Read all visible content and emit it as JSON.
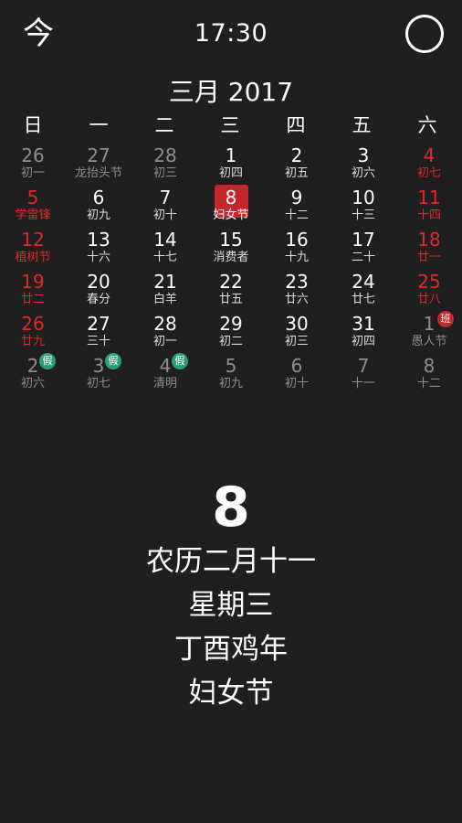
{
  "header": {
    "today_label": "今",
    "time": "17:30"
  },
  "month_title": "三月 2017",
  "weekdays": [
    "日",
    "一",
    "二",
    "三",
    "四",
    "五",
    "六"
  ],
  "days": [
    {
      "num": "26",
      "lunar": "初一",
      "style": "dim"
    },
    {
      "num": "27",
      "lunar": "龙抬头节",
      "style": "dim"
    },
    {
      "num": "28",
      "lunar": "初三",
      "style": "dim"
    },
    {
      "num": "1",
      "lunar": "初四",
      "style": "normal"
    },
    {
      "num": "2",
      "lunar": "初五",
      "style": "normal"
    },
    {
      "num": "3",
      "lunar": "初六",
      "style": "normal"
    },
    {
      "num": "4",
      "lunar": "初七",
      "style": "weekend"
    },
    {
      "num": "5",
      "lunar": "学雷锋",
      "style": "weekend"
    },
    {
      "num": "6",
      "lunar": "初九",
      "style": "normal"
    },
    {
      "num": "7",
      "lunar": "初十",
      "style": "normal"
    },
    {
      "num": "8",
      "lunar": "妇女节",
      "style": "selected"
    },
    {
      "num": "9",
      "lunar": "十二",
      "style": "normal"
    },
    {
      "num": "10",
      "lunar": "十三",
      "style": "normal"
    },
    {
      "num": "11",
      "lunar": "十四",
      "style": "weekend"
    },
    {
      "num": "12",
      "lunar": "植树节",
      "style": "weekend"
    },
    {
      "num": "13",
      "lunar": "十六",
      "style": "normal"
    },
    {
      "num": "14",
      "lunar": "十七",
      "style": "normal"
    },
    {
      "num": "15",
      "lunar": "消费者",
      "style": "normal"
    },
    {
      "num": "16",
      "lunar": "十九",
      "style": "normal"
    },
    {
      "num": "17",
      "lunar": "二十",
      "style": "normal"
    },
    {
      "num": "18",
      "lunar": "廿一",
      "style": "weekend"
    },
    {
      "num": "19",
      "lunar": "廿二",
      "style": "weekend"
    },
    {
      "num": "20",
      "lunar": "春分",
      "style": "normal"
    },
    {
      "num": "21",
      "lunar": "白羊",
      "style": "normal"
    },
    {
      "num": "22",
      "lunar": "廿五",
      "style": "normal"
    },
    {
      "num": "23",
      "lunar": "廿六",
      "style": "normal"
    },
    {
      "num": "24",
      "lunar": "廿七",
      "style": "normal"
    },
    {
      "num": "25",
      "lunar": "廿八",
      "style": "weekend"
    },
    {
      "num": "26",
      "lunar": "廿九",
      "style": "weekend"
    },
    {
      "num": "27",
      "lunar": "三十",
      "style": "normal"
    },
    {
      "num": "28",
      "lunar": "初一",
      "style": "normal"
    },
    {
      "num": "29",
      "lunar": "初二",
      "style": "normal"
    },
    {
      "num": "30",
      "lunar": "初三",
      "style": "normal"
    },
    {
      "num": "31",
      "lunar": "初四",
      "style": "normal"
    },
    {
      "num": "1",
      "lunar": "愚人节",
      "style": "dim",
      "badge": "班",
      "badge_type": "work"
    },
    {
      "num": "2",
      "lunar": "初六",
      "style": "dim",
      "badge": "假",
      "badge_type": "holiday"
    },
    {
      "num": "3",
      "lunar": "初七",
      "style": "dim",
      "badge": "假",
      "badge_type": "holiday"
    },
    {
      "num": "4",
      "lunar": "清明",
      "style": "dim",
      "badge": "假",
      "badge_type": "holiday"
    },
    {
      "num": "5",
      "lunar": "初九",
      "style": "dim"
    },
    {
      "num": "6",
      "lunar": "初十",
      "style": "dim"
    },
    {
      "num": "7",
      "lunar": "十一",
      "style": "dim"
    },
    {
      "num": "8",
      "lunar": "十二",
      "style": "dim"
    }
  ],
  "detail": {
    "day": "8",
    "lunar_date": "农历二月十一",
    "weekday": "星期三",
    "year_name": "丁酉鸡年",
    "festival": "妇女节"
  },
  "colors": {
    "background": "#1f1f1f",
    "weekend_red": "#e2282a",
    "selected_bg": "#c4272b",
    "holiday_badge": "#2e9e7a",
    "work_badge": "#c4272b",
    "dim_text": "#8e8e8e"
  }
}
